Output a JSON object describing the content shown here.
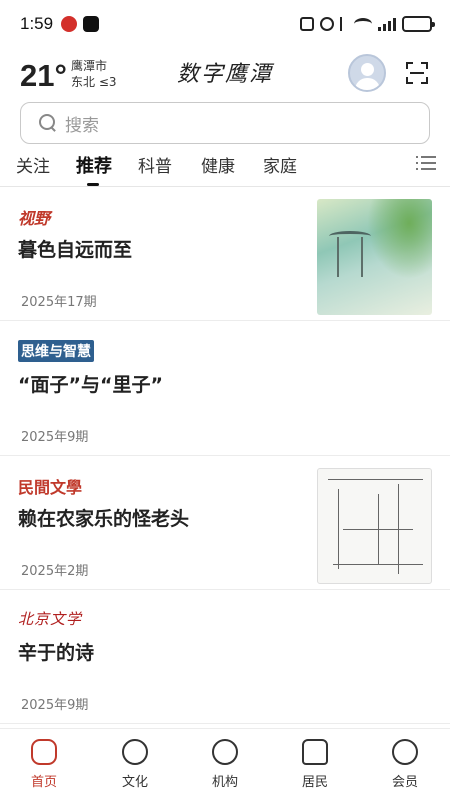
{
  "status_bar": {
    "time": "1:59",
    "battery_level": 0.85
  },
  "header": {
    "temperature": "21°",
    "city": "鹰潭市",
    "wind": "东北 ≤3",
    "brand": "数字鹰潭"
  },
  "search": {
    "placeholder": "搜索"
  },
  "tabs": [
    {
      "label": "关注",
      "active": false
    },
    {
      "label": "推荐",
      "active": true
    },
    {
      "label": "科普",
      "active": false
    },
    {
      "label": "健康",
      "active": false
    },
    {
      "label": "家庭",
      "active": false
    }
  ],
  "articles": [
    {
      "source": "视野",
      "title": "暮色自远而至",
      "issue": "2025年17期",
      "has_thumbnail": true
    },
    {
      "source": "思维与智慧",
      "title": "“面子”与“里子”",
      "issue": "2025年9期",
      "has_thumbnail": false
    },
    {
      "source": "民間文學",
      "title": "赖在农家乐的怪老头",
      "issue": "2025年2期",
      "has_thumbnail": true
    },
    {
      "source": "北京文学",
      "title": "辛于的诗",
      "issue": "2025年9期",
      "has_thumbnail": false
    }
  ],
  "bottom_nav": [
    {
      "label": "首页",
      "icon": "home-icon",
      "active": true
    },
    {
      "label": "文化",
      "icon": "culture-icon",
      "active": false
    },
    {
      "label": "机构",
      "icon": "phone-icon",
      "active": false
    },
    {
      "label": "居民",
      "icon": "resident-icon",
      "active": false
    },
    {
      "label": "会员",
      "icon": "member-icon",
      "active": false
    }
  ],
  "colors": {
    "accent": "#c0392b",
    "text": "#222222"
  }
}
